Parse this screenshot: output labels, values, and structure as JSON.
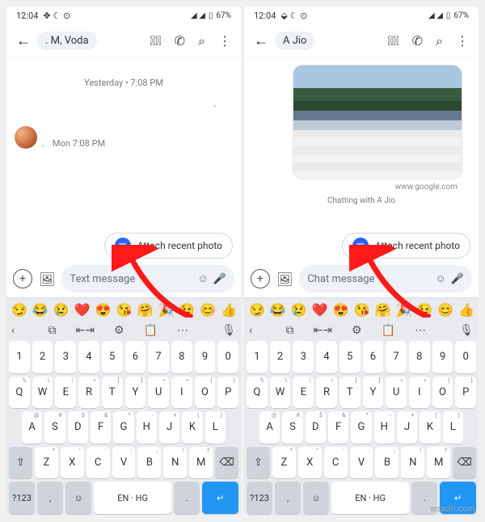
{
  "status": {
    "time": "12:04",
    "battery": "67%"
  },
  "left": {
    "contact": ". M, Voda",
    "ts1": "Yesterday • 7:08 PM",
    "ts2": "Mon 7:08 PM",
    "attach": "Attach recent photo",
    "placeholder": "Text message"
  },
  "right": {
    "contact": "A Jio",
    "url": "www.google.com",
    "chatwith": "Chatting with A Jio",
    "attach": "Attach recent photo",
    "placeholder": "Chat message"
  },
  "keyboard": {
    "emoji": [
      "😏",
      "😂",
      "😢",
      "❤️",
      "😍",
      "😘",
      "🤗",
      "🎉",
      "😉",
      "😊",
      "👍"
    ],
    "numbers": [
      "1",
      "2",
      "3",
      "4",
      "5",
      "6",
      "7",
      "8",
      "9",
      "0"
    ],
    "row1": [
      "Q",
      "W",
      "E",
      "R",
      "T",
      "Y",
      "U",
      "I",
      "O",
      "P"
    ],
    "row1sup": [
      "%",
      "\\",
      "|",
      "=",
      "[",
      "]",
      "<",
      ">",
      "{",
      "}"
    ],
    "row2": [
      "A",
      "S",
      "D",
      "F",
      "G",
      "H",
      "J",
      "K",
      "L"
    ],
    "row2sup": [
      "@",
      "#",
      "$",
      "&",
      "*",
      "-",
      "+",
      "(",
      ")"
    ],
    "row3": [
      "Z",
      "X",
      "C",
      "V",
      "B",
      "N",
      "M"
    ],
    "row3sup": [
      "*",
      "\"",
      "'",
      ":",
      ";",
      "!",
      "?"
    ],
    "sym": "?123",
    "lang": "EN · HG",
    "comma": ",",
    "period": "."
  },
  "watermark": "wsxdn.com"
}
